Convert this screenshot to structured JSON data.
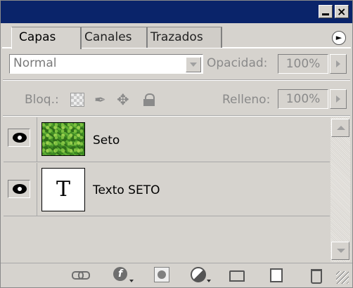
{
  "titlebar": {
    "min_glyph": "",
    "close_glyph": "×"
  },
  "tabs": [
    {
      "label": "Capas",
      "active": true
    },
    {
      "label": "Canales",
      "active": false
    },
    {
      "label": "Trazados",
      "active": false
    }
  ],
  "menu_icon": "panel-menu-arrow-icon",
  "blend_mode": {
    "value": "Normal"
  },
  "opacity": {
    "label": "Opacidad:",
    "value": "100%"
  },
  "lock": {
    "label": "Bloq.:",
    "icons": [
      "lock-transparency-icon",
      "lock-paint-icon",
      "lock-move-icon",
      "lock-all-icon"
    ]
  },
  "fill": {
    "label": "Relleno:",
    "value": "100%"
  },
  "layers": [
    {
      "name": "Seto",
      "visible": true,
      "thumbnail": "hedge-texture"
    },
    {
      "name": "Texto SETO",
      "visible": true,
      "thumbnail": "text-layer",
      "thumb_glyph": "T"
    }
  ],
  "bottom_toolbar": [
    "link-layers-icon",
    "layer-style-icon",
    "add-mask-icon",
    "new-adjustment-layer-icon",
    "new-group-icon",
    "new-layer-icon",
    "delete-layer-icon"
  ],
  "colors": {
    "titlebar": "#0a246a",
    "panel": "#d6d3ce",
    "disabled_text": "#8a8a8a"
  }
}
